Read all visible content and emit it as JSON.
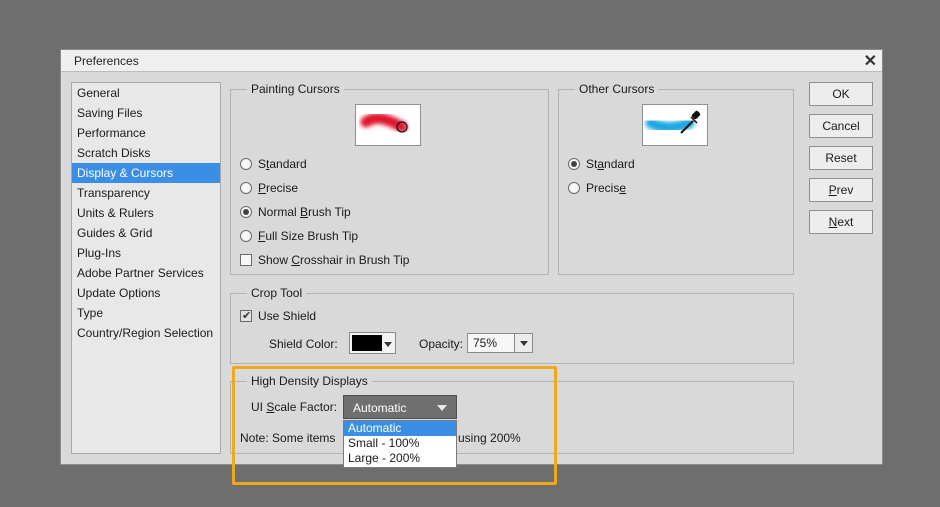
{
  "window": {
    "title": "Preferences",
    "close_glyph": "✕"
  },
  "sidebar": {
    "items": [
      {
        "label": "General",
        "selected": false
      },
      {
        "label": "Saving Files",
        "selected": false
      },
      {
        "label": "Performance",
        "selected": false
      },
      {
        "label": "Scratch Disks",
        "selected": false
      },
      {
        "label": "Display & Cursors",
        "selected": true
      },
      {
        "label": "Transparency",
        "selected": false
      },
      {
        "label": "Units & Rulers",
        "selected": false
      },
      {
        "label": "Guides & Grid",
        "selected": false
      },
      {
        "label": "Plug-Ins",
        "selected": false
      },
      {
        "label": "Adobe Partner Services",
        "selected": false
      },
      {
        "label": "Update Options",
        "selected": false
      },
      {
        "label": "Type",
        "selected": false
      },
      {
        "label": "Country/Region Selection",
        "selected": false
      }
    ]
  },
  "painting_cursors": {
    "title": "Painting Cursors",
    "preview_icon": "red-brush-stroke-with-circle-cursor",
    "options": [
      {
        "pre": "S",
        "u": "t",
        "post": "andard",
        "type": "radio",
        "checked": false
      },
      {
        "pre": "",
        "u": "P",
        "post": "recise",
        "type": "radio",
        "checked": false
      },
      {
        "pre": "Normal ",
        "u": "B",
        "post": "rush Tip",
        "type": "radio",
        "checked": true
      },
      {
        "pre": "",
        "u": "F",
        "post": "ull Size Brush Tip",
        "type": "radio",
        "checked": false
      },
      {
        "pre": "Show ",
        "u": "C",
        "post": "rosshair in Brush Tip",
        "type": "checkbox",
        "checked": false
      }
    ]
  },
  "other_cursors": {
    "title": "Other Cursors",
    "preview_icon": "blue-brush-stroke-with-eyedropper",
    "options": [
      {
        "pre": "St",
        "u": "a",
        "post": "ndard",
        "checked": true
      },
      {
        "pre": "Precis",
        "u": "e",
        "post": "",
        "checked": false
      }
    ]
  },
  "crop_tool": {
    "title": "Crop Tool",
    "use_shield_label": "Use Shield",
    "use_shield_checked": true,
    "shield_color_label": "Shield Color:",
    "shield_color": "#000000",
    "opacity_label": "Opacity:",
    "opacity_value": "75%"
  },
  "high_density": {
    "title": "High Density Displays",
    "scale_label_pre": "UI ",
    "scale_label_u": "S",
    "scale_label_post": "cale Factor:",
    "scale_value": "Automatic",
    "note_left": "Note: Some items",
    "note_right": "using 200%",
    "dropdown_options": [
      "Automatic",
      "Small - 100%",
      "Large - 200%"
    ],
    "highlighted_option": "Automatic"
  },
  "buttons": {
    "ok": "OK",
    "cancel": "Cancel",
    "reset": "Reset",
    "prev_u": "P",
    "prev_rest": "rev",
    "next_u": "N",
    "next_rest": "ext"
  },
  "colors": {
    "accent": "#3a8ee6",
    "highlight_frame": "#f0a91c",
    "background": "#6e6e6e",
    "dialog": "#d9d9d9"
  }
}
